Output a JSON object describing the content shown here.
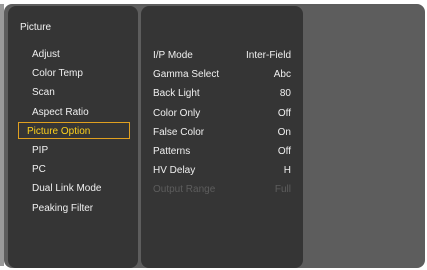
{
  "menu": {
    "title": "Picture",
    "items": [
      {
        "label": "Adjust"
      },
      {
        "label": "Color Temp"
      },
      {
        "label": "Scan"
      },
      {
        "label": "Aspect Ratio"
      },
      {
        "label": "Picture Option",
        "selected": true
      },
      {
        "label": "PIP"
      },
      {
        "label": "PC"
      },
      {
        "label": "Dual Link Mode"
      },
      {
        "label": "Peaking Filter"
      }
    ]
  },
  "settings": {
    "rows": [
      {
        "label": "I/P Mode",
        "value": "Inter-Field"
      },
      {
        "label": "Gamma Select",
        "value": "Abc"
      },
      {
        "label": "Back Light",
        "value": "80"
      },
      {
        "label": "Color Only",
        "value": "Off"
      },
      {
        "label": "False Color",
        "value": "On"
      },
      {
        "label": "Patterns",
        "value": "Off"
      },
      {
        "label": "HV Delay",
        "value": "H"
      },
      {
        "label": "Output Range",
        "value": "Full",
        "disabled": true
      }
    ]
  },
  "colors": {
    "panel": "#353535",
    "frame": "#5d5d5d",
    "text": "#f0f0f0",
    "highlight_text": "#ffd21c",
    "highlight_border": "#e0a020",
    "disabled_text": "#5d5d5d"
  }
}
